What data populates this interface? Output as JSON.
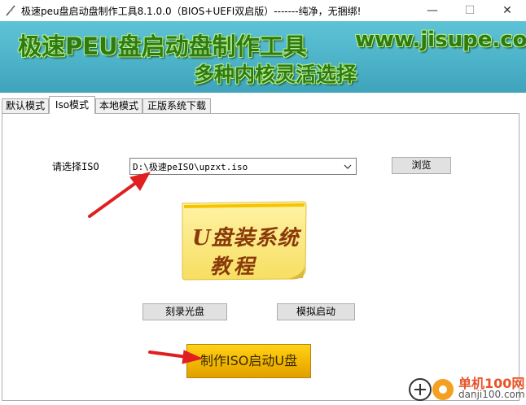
{
  "window": {
    "title": "极速peu盘启动盘制作工具8.1.0.0（BIOS+UEFI双启版）-------纯净，无捆绑!",
    "minimize": "—",
    "maximize": "☐",
    "close": "✕"
  },
  "banner": {
    "title": "极速PEU盘启动盘制作工具",
    "url": "www.jisupe.com",
    "subtitle": "多种内核灵活选择",
    "bg_color": "#4db3c9",
    "text_color": "#2f7a12"
  },
  "tabs": [
    {
      "label": "默认模式",
      "active": false
    },
    {
      "label": "Iso模式",
      "active": true
    },
    {
      "label": "本地模式",
      "active": false
    },
    {
      "label": "正版系统下载",
      "active": false
    }
  ],
  "iso_form": {
    "label": "请选择ISO",
    "selected_path": "D:\\极速peISO\\upzxt.iso",
    "browse_label": "浏览"
  },
  "promo_note": {
    "line1": "U盘装系统",
    "line2": "教程",
    "icon": "sticky-note-icon"
  },
  "actions": {
    "burn_label": "刻录光盘",
    "simulate_label": "模拟启动",
    "make_label": "制作ISO启动U盘",
    "make_color": "#f0b400"
  },
  "watermark": {
    "line1": "单机100网",
    "line2": "danji100.com",
    "icon": "plus-circle-icon"
  }
}
